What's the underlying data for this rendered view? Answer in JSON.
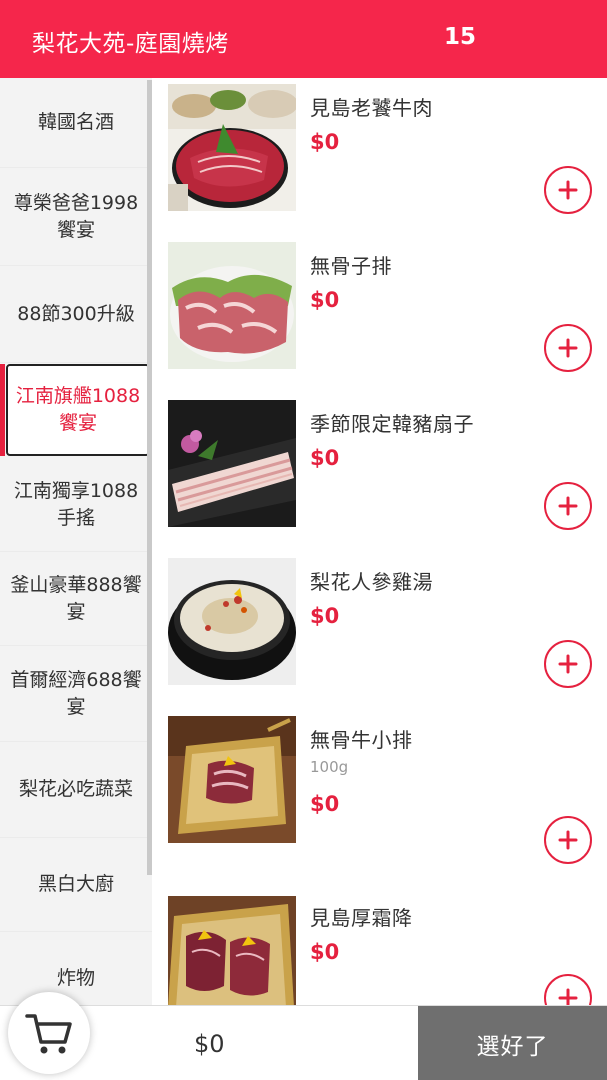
{
  "header": {
    "title": "梨花大苑-庭園燒烤",
    "table_number": "15"
  },
  "sidebar": {
    "categories": [
      {
        "label": "韓國名酒"
      },
      {
        "label": "尊榮爸爸1998饗宴"
      },
      {
        "label": "88節300升級"
      },
      {
        "label": "江南旗艦1088饗宴",
        "active": true
      },
      {
        "label": "江南獨享1088手搖"
      },
      {
        "label": "釜山豪華888饗宴"
      },
      {
        "label": "首爾經濟688饗宴"
      },
      {
        "label": "梨花必吃蔬菜"
      },
      {
        "label": "黑白大廚"
      },
      {
        "label": "炸物"
      }
    ]
  },
  "products": [
    {
      "name": "見島老饕牛肉",
      "price": "$0",
      "image": "beef-platter-photo"
    },
    {
      "name": "無骨子排",
      "price": "$0",
      "image": "boneless-short-rib-photo"
    },
    {
      "name": "季節限定韓豬扇子",
      "price": "$0",
      "image": "pork-fan-slices-photo"
    },
    {
      "name": "梨花人參雞湯",
      "price": "$0",
      "image": "ginseng-chicken-soup-photo"
    },
    {
      "name": "無骨牛小排",
      "unit": "100g",
      "price": "$0",
      "image": "boneless-beef-rib-photo"
    },
    {
      "name": "見島厚霜降",
      "price": "$0",
      "image": "thick-marbled-beef-photo"
    }
  ],
  "footer": {
    "total": "$0",
    "done_label": "選好了",
    "cart_icon": "cart-icon"
  },
  "colors": {
    "brand_red": "#f5264b",
    "price_red": "#e5213f",
    "done_button_gray": "#6f6f6f"
  }
}
